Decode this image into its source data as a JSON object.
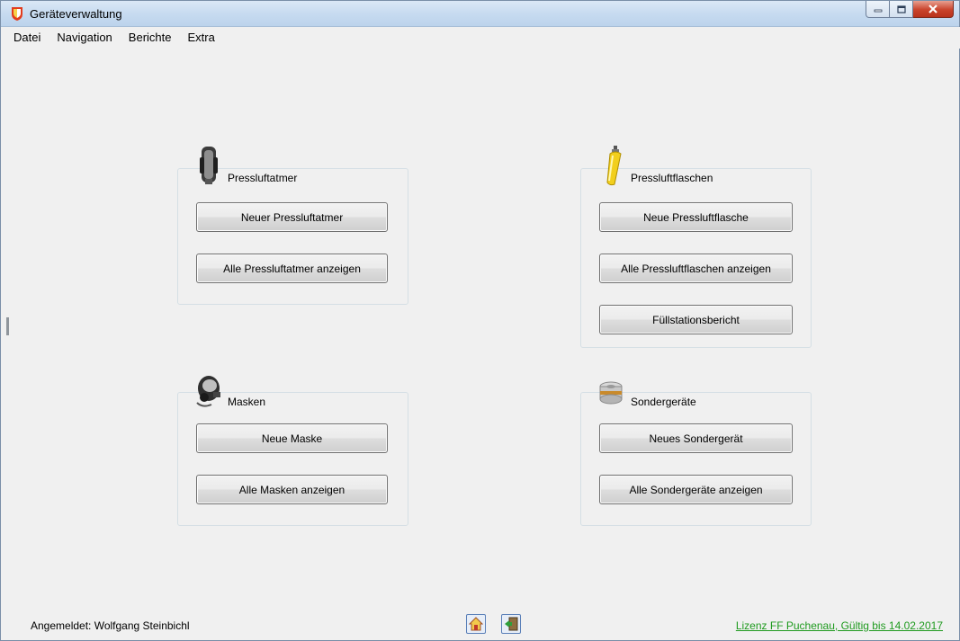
{
  "window": {
    "title": "Geräteverwaltung",
    "controls": [
      "minimize-icon",
      "maximize-icon",
      "close-icon"
    ]
  },
  "menu": [
    "Datei",
    "Navigation",
    "Berichte",
    "Extra"
  ],
  "groups": {
    "pressluftatmer": {
      "title": "Pressluftatmer",
      "icon": "breathing-apparatus-icon",
      "buttons": [
        "Neuer Pressluftatmer",
        "Alle Pressluftatmer anzeigen"
      ]
    },
    "pressluftflaschen": {
      "title": "Pressluftflaschen",
      "icon": "air-cylinder-icon",
      "buttons": [
        "Neue Pressluftflasche",
        "Alle Pressluftflaschen anzeigen",
        "Füllstationsbericht"
      ]
    },
    "masken": {
      "title": "Masken",
      "icon": "mask-icon",
      "buttons": [
        "Neue Maske",
        "Alle Masken anzeigen"
      ]
    },
    "sondergeraete": {
      "title": "Sondergeräte",
      "icon": "filter-canister-icon",
      "buttons": [
        "Neues Sondergerät",
        "Alle Sondergeräte anzeigen"
      ]
    }
  },
  "status": {
    "logged_in": "Angemeldet: Wolfgang Steinbichl",
    "license": "Lizenz FF Puchenau, Gültig bis 14.02.2017",
    "tools": [
      "home-icon",
      "exit-door-icon"
    ]
  },
  "colors": {
    "license_link": "#1e9a1e",
    "titlebar": "#c7dbf0",
    "close_button": "#c9432b"
  }
}
